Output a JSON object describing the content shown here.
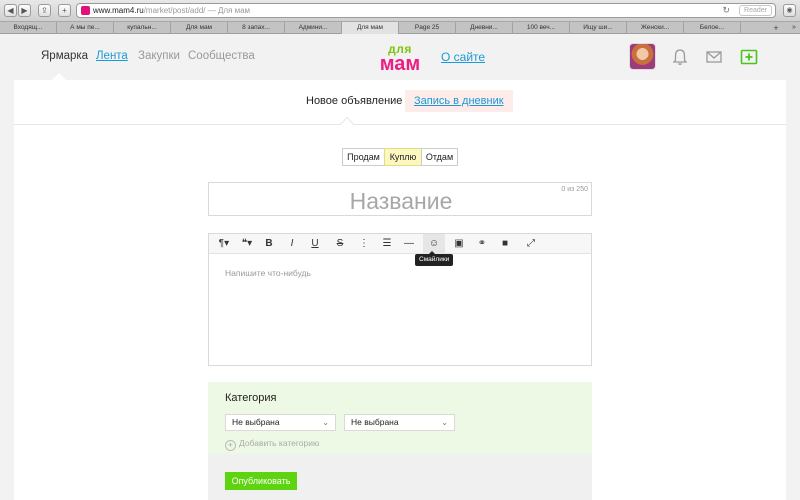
{
  "browser": {
    "url_host": "www.mam4.ru",
    "url_path": "/market/post/add/",
    "url_title": " — Для мам",
    "reader_label": "Reader",
    "reload_glyph": "↻",
    "tabs": [
      "Входящ...",
      "А мы пе...",
      "купальн...",
      "Для мам",
      "8 запах...",
      "Админи...",
      "Для мам",
      "Page 25",
      "Дневни...",
      "100 веч...",
      "Ищу ши...",
      "Женски...",
      "Белое..."
    ],
    "active_tab_index": 6,
    "new_tab_glyph": "+",
    "more_tabs_glyph": "»"
  },
  "header": {
    "nav": [
      {
        "label": "Ярмарка",
        "state": "current"
      },
      {
        "label": "Лента",
        "state": "link"
      },
      {
        "label": "Закупки",
        "state": "muted"
      },
      {
        "label": "Сообщества",
        "state": "muted"
      }
    ],
    "logo_top": "для",
    "logo_bottom": "мам",
    "about_label": "О сайте",
    "colors": {
      "link": "#1a9ad6",
      "logo_green": "#7ac70c",
      "logo_pink": "#ee1c83",
      "accent_green": "#5dd40f"
    }
  },
  "subtabs": {
    "new_ad": "Новое объявление",
    "diary": "Запись в дневник"
  },
  "deal_type": {
    "options": [
      "Продам",
      "Куплю",
      "Отдам"
    ],
    "selected": "Куплю"
  },
  "title_field": {
    "placeholder": "Название",
    "counter": "0 из 250"
  },
  "editor": {
    "toolbar": [
      "paragraph-icon",
      "quote-icon",
      "bold-icon",
      "italic-icon",
      "underline-icon",
      "strikethrough-icon",
      "ordered-list-icon",
      "unordered-list-icon",
      "horizontal-rule-icon",
      "smiley-icon",
      "image-icon",
      "link-icon",
      "video-icon",
      "fullscreen-icon"
    ],
    "toolbar_glyphs": [
      "¶▾",
      "❝▾",
      "B",
      "I",
      "U",
      "S",
      "⋮",
      "☰",
      "—",
      "☺",
      "▣",
      "⚭",
      "■",
      "⤢"
    ],
    "tooltip": "Смайлики",
    "placeholder": "Напишите что-нибудь"
  },
  "category": {
    "title": "Категория",
    "select1": "Не выбрана",
    "select2": "Не выбрана",
    "add_label": "Добавить категорию"
  },
  "publish_label": "Опубликовать"
}
